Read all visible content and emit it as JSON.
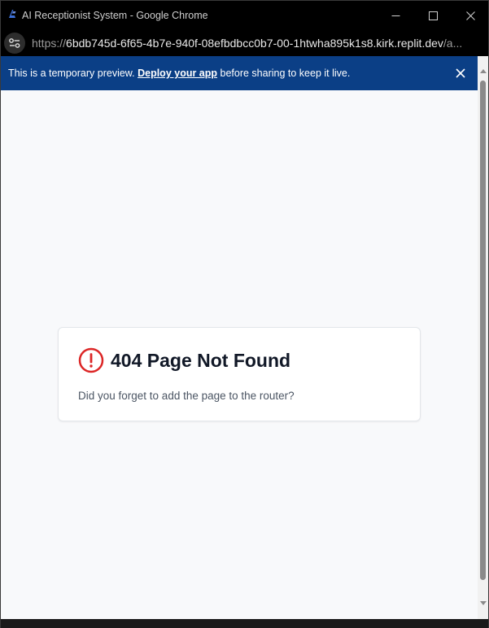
{
  "window": {
    "title": "AI Receptionist System - Google Chrome"
  },
  "address_bar": {
    "scheme": "https://",
    "host": "6bdb745d-6f65-4b7e-940f-08efbdbcc0b7-00-1htwha895k1s8.kirk.replit.dev",
    "path_tail": "/a..."
  },
  "banner": {
    "text_before": "This is a temporary preview. ",
    "link_label": "Deploy your app",
    "text_after": " before sharing to keep it live."
  },
  "error_card": {
    "title": "404 Page Not Found",
    "message": "Did you forget to add the page to the router?"
  },
  "colors": {
    "banner_bg": "#0b3f86",
    "error_icon": "#dc2626",
    "page_bg": "#f8f9fb"
  },
  "icons": {
    "window_minimize": "minimize-icon",
    "window_maximize": "maximize-icon",
    "window_close": "close-icon",
    "site_info": "tune-icon",
    "banner_close": "close-icon",
    "error": "alert-circle-icon"
  }
}
